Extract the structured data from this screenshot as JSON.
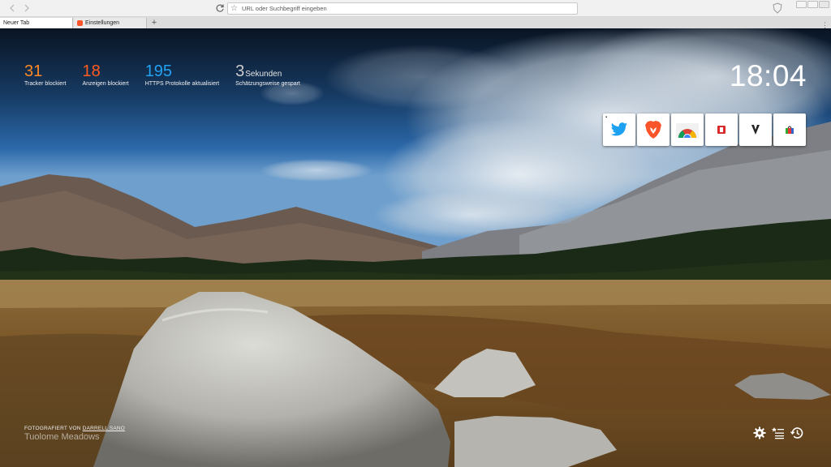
{
  "toolbar": {
    "back_icon": "chevron-left-icon",
    "forward_icon": "chevron-right-icon",
    "reload_icon": "reload-icon",
    "url_placeholder": "URL oder Suchbegriff eingeben",
    "url_value": "",
    "shield_icon": "brave-shield-icon"
  },
  "tabs": [
    {
      "label": "Neuer Tab",
      "active": true
    },
    {
      "label": "Einstellungen",
      "active": false,
      "favicon": "brave-lion-icon"
    }
  ],
  "new_tab_button": "+",
  "stats": [
    {
      "number": "31",
      "unit": "",
      "label": "Tracker blockiert",
      "color": "#ff8a25"
    },
    {
      "number": "18",
      "unit": "",
      "label": "Anzeigen blockiert",
      "color": "#ff5b1f"
    },
    {
      "number": "195",
      "unit": "",
      "label": "HTTPS Protokolle aktualisiert",
      "color": "#22a2f3"
    },
    {
      "number": "3",
      "unit": "Sekunden",
      "label": "Schätzungsweise gespart",
      "color": "#cccccc"
    }
  ],
  "clock": "18:04",
  "top_sites": [
    {
      "name": "twitter",
      "icon": "twitter-bird-icon",
      "pinned": true
    },
    {
      "name": "brave",
      "icon": "brave-lion-icon",
      "pinned": false
    },
    {
      "name": "chrome-web-store",
      "icon": "chrome-web-store-icon",
      "pinned": false
    },
    {
      "name": "site-4",
      "icon": "red-app-icon",
      "pinned": false
    },
    {
      "name": "site-5",
      "icon": "letter-logo-icon",
      "pinned": false
    },
    {
      "name": "site-6",
      "icon": "colorful-bag-icon",
      "pinned": false
    }
  ],
  "photo": {
    "credit_prefix": "FOTOGRAFIERT VON",
    "photographer": "DARRELL SANO",
    "location": "Tuolome Meadows"
  },
  "actions": [
    {
      "name": "settings",
      "icon": "gear-icon"
    },
    {
      "name": "bookmarks",
      "icon": "bookmarks-list-icon"
    },
    {
      "name": "history",
      "icon": "history-clock-icon"
    }
  ]
}
